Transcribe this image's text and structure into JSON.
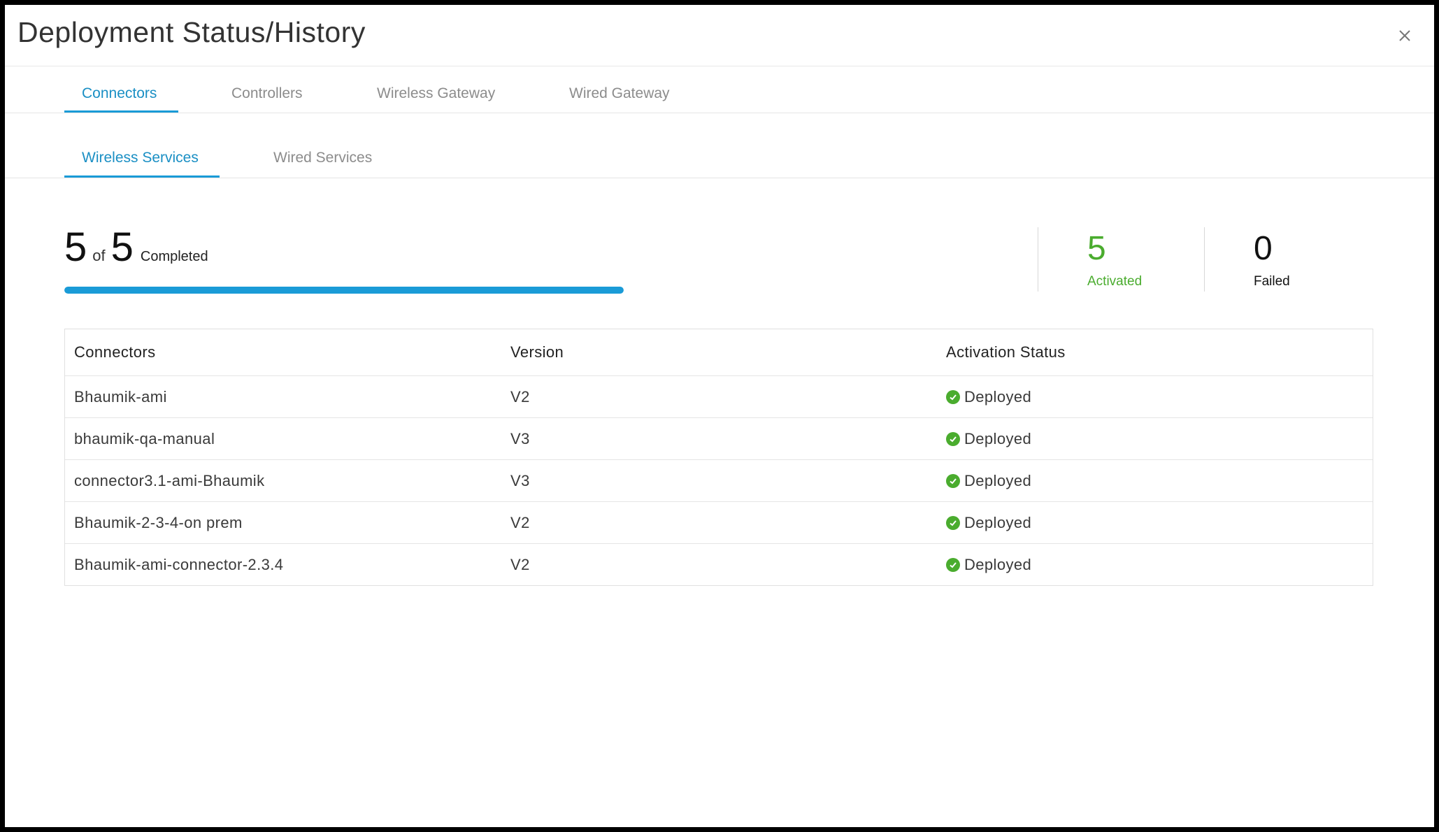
{
  "dialog": {
    "title": "Deployment Status/History",
    "close_icon": "close-icon"
  },
  "primary_tabs": [
    {
      "label": "Connectors",
      "active": true
    },
    {
      "label": "Controllers",
      "active": false
    },
    {
      "label": "Wireless Gateway",
      "active": false
    },
    {
      "label": "Wired Gateway",
      "active": false
    }
  ],
  "secondary_tabs": [
    {
      "label": "Wireless Services",
      "active": true
    },
    {
      "label": "Wired Services",
      "active": false
    }
  ],
  "summary": {
    "done": "5",
    "of_label": "of",
    "total": "5",
    "completed_label": "Completed",
    "progress_fraction": 1.0
  },
  "stats": {
    "activated_value": "5",
    "activated_label": "Activated",
    "failed_value": "0",
    "failed_label": "Failed"
  },
  "table": {
    "headers": [
      "Connectors",
      "Version",
      "Activation Status"
    ],
    "rows": [
      {
        "name": "Bhaumik-ami",
        "version": "V2",
        "status": "Deployed"
      },
      {
        "name": "bhaumik-qa-manual",
        "version": "V3",
        "status": "Deployed"
      },
      {
        "name": "connector3.1-ami-Bhaumik",
        "version": "V3",
        "status": "Deployed"
      },
      {
        "name": "Bhaumik-2-3-4-on prem",
        "version": "V2",
        "status": "Deployed"
      },
      {
        "name": "Bhaumik-ami-connector-2.3.4",
        "version": "V2",
        "status": "Deployed"
      }
    ]
  },
  "colors": {
    "accent": "#1a9bd7",
    "success": "#4aac2e"
  }
}
